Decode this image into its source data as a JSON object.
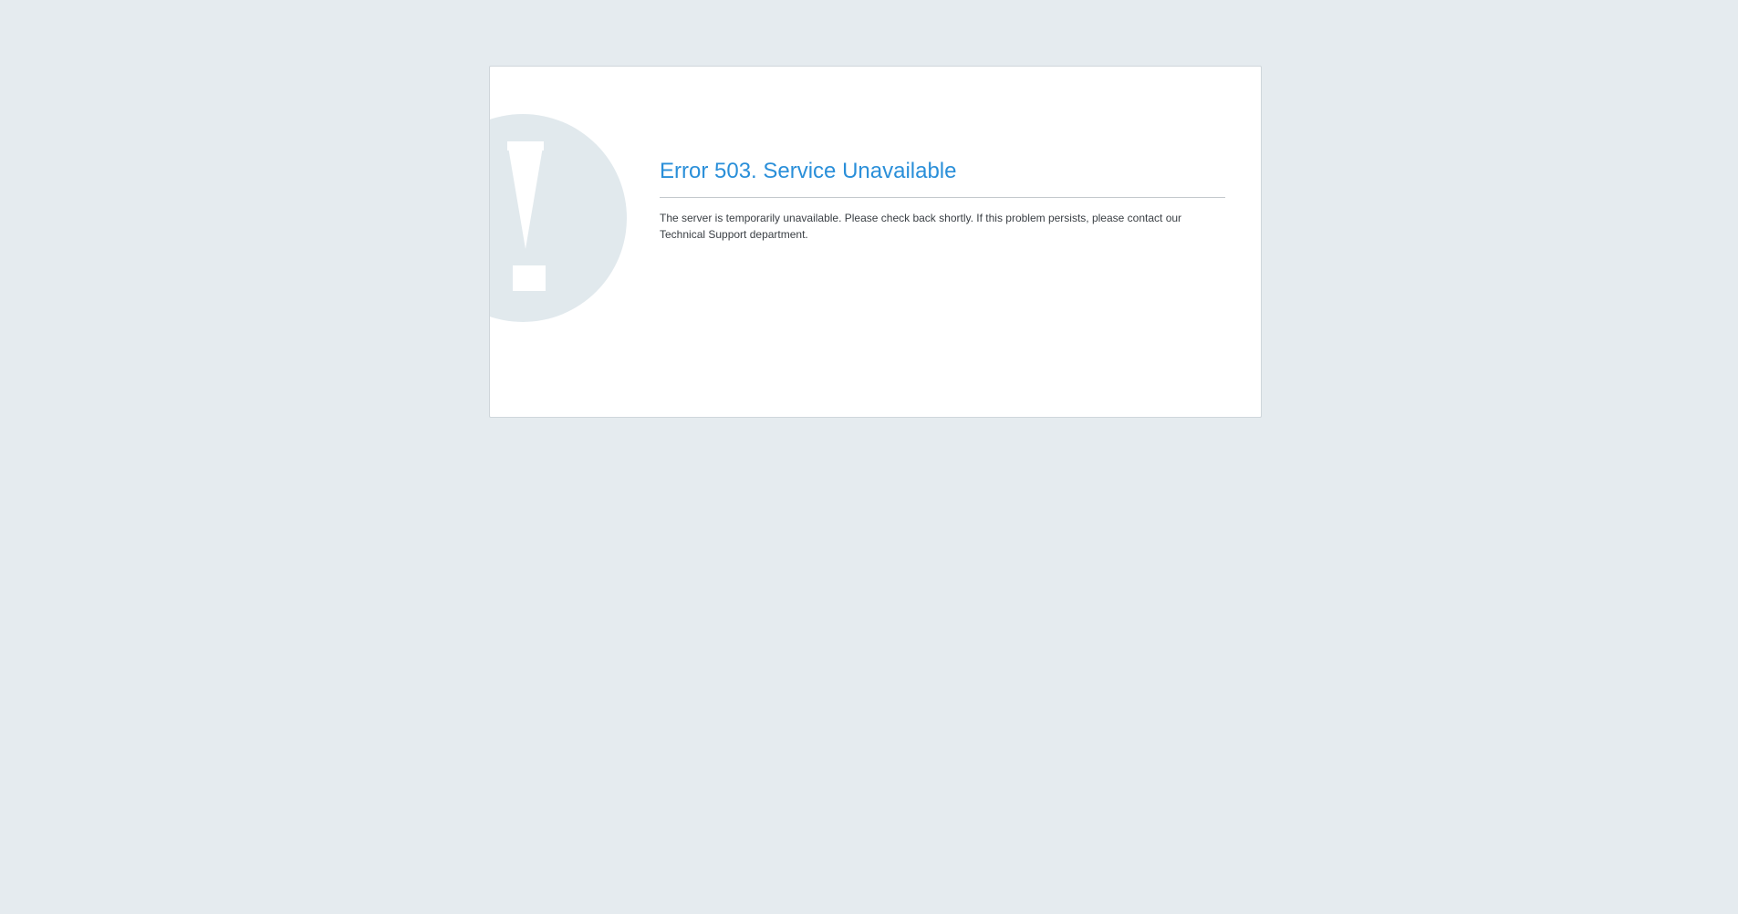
{
  "error": {
    "title": "Error 503. Service Unavailable",
    "message": "The server is temporarily unavailable. Please check back shortly. If this problem persists, please contact our Technical Support department."
  },
  "icon": {
    "name": "warning-exclamation-icon"
  },
  "colors": {
    "background": "#e5ebef",
    "card": "#ffffff",
    "title": "#2a8fd9",
    "icon_circle": "#e1e9ed"
  }
}
